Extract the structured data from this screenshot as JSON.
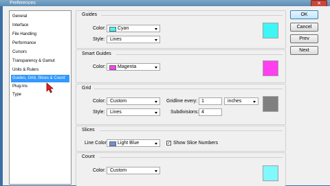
{
  "window": {
    "title": "Preferences",
    "close_glyph": "✕"
  },
  "sidebar": {
    "items": [
      {
        "label": "General"
      },
      {
        "label": "Interface"
      },
      {
        "label": "File Handling"
      },
      {
        "label": "Performance"
      },
      {
        "label": "Cursors"
      },
      {
        "label": "Transparency & Gamut"
      },
      {
        "label": "Units & Rulers"
      },
      {
        "label": "Guides, Grid, Slices & Count",
        "selected": true
      },
      {
        "label": "Plug-Ins"
      },
      {
        "label": "Type"
      }
    ]
  },
  "guides": {
    "title": "Guides",
    "color_label": "Color:",
    "color_value": "Cyan",
    "color_hex": "#3ff6f6",
    "style_label": "Style:",
    "style_value": "Lines",
    "swatch_hex": "#3ff6f6"
  },
  "smart_guides": {
    "title": "Smart Guides",
    "color_label": "Color:",
    "color_value": "Magenta",
    "color_hex": "#ff3ff0",
    "swatch_hex": "#ff3ff0"
  },
  "grid": {
    "title": "Grid",
    "color_label": "Color:",
    "color_value": "Custom",
    "style_label": "Style:",
    "style_value": "Lines",
    "gridline_label": "Gridline every:",
    "gridline_value": "1",
    "gridline_unit": "inches",
    "subdiv_label": "Subdivisions:",
    "subdiv_value": "4",
    "swatch_hex": "#808080"
  },
  "slices": {
    "title": "Slices",
    "line_color_label": "Line Color:",
    "line_color_value": "Light Blue",
    "line_color_hex": "#6f8fdc",
    "show_numbers_label": "Show Slice Numbers",
    "show_numbers_checked": true,
    "check_glyph": "✓"
  },
  "count": {
    "title": "Count",
    "color_label": "Color:",
    "color_value": "Custom",
    "swatch_hex": "#80f8fc"
  },
  "buttons": {
    "ok": "OK",
    "cancel": "Cancel",
    "prev": "Prev",
    "next": "Next"
  }
}
